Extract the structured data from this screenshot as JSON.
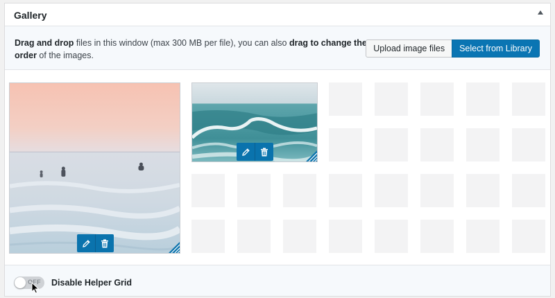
{
  "gallery": {
    "title": "Gallery",
    "instructions": {
      "part1_bold": "Drag and drop",
      "part2": " files in this window (max 300 MB per file), you can also ",
      "part3_bold": "drag to change the order",
      "part4": " of the images."
    },
    "buttons": {
      "upload_label": "Upload image files",
      "library_label": "Select from Library"
    },
    "images": [
      {
        "name": "surfers-pink-sky",
        "edit_icon": "pencil-icon",
        "delete_icon": "trash-icon"
      },
      {
        "name": "ocean-wave",
        "edit_icon": "pencil-icon",
        "delete_icon": "trash-icon"
      }
    ],
    "footer": {
      "toggle_state": "OFF",
      "toggle_label": "Disable Helper Grid"
    }
  },
  "colors": {
    "primary": "#0a75b3",
    "tool_bar": "#0a73ad",
    "grid_cell": "#f3f3f4"
  }
}
